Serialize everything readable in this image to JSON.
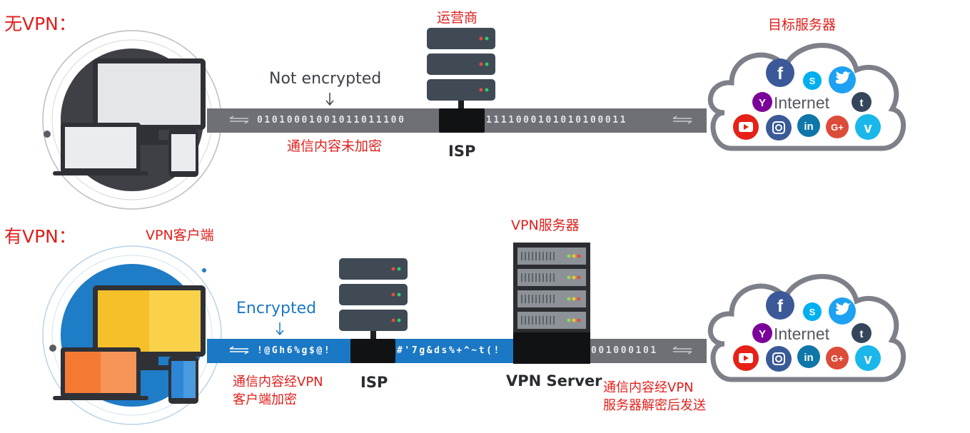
{
  "top": {
    "heading": "无VPN：",
    "isp_operator_label": "运营商",
    "target_server_label": "目标服务器",
    "not_encrypted": "Not encrypted",
    "left_bits": "01010001001011011100",
    "right_bits": "1111000101010100011",
    "note": "通信内容未加密",
    "isp": "ISP",
    "internet": "Internet"
  },
  "bottom": {
    "heading": "有VPN：",
    "client_label": "VPN客户端",
    "vpn_server_label": "VPN服务器",
    "encrypted": "Encrypted",
    "enc_text_1": "!@Gh6%g$@!",
    "enc_text_2": "#'7g&ds%+^~t(!",
    "right_bits": "001000101",
    "isp": "ISP",
    "vpn_server": "VPN Server",
    "note_client_line1": "通信内容经VPN",
    "note_client_line2": "客户端加密",
    "note_server_line1": "通信内容经VPN",
    "note_server_line2": "服务器解密后发送",
    "internet": "Internet"
  },
  "colors": {
    "red_label": "#e0201c",
    "tube_gray": "#6e7076",
    "tube_blue": "#1b78c4",
    "server_dark": "#3f4a55",
    "screen_yellow": "#f6c02a",
    "laptop_orange": "#f47a33"
  },
  "icons": [
    "facebook-icon",
    "skype-icon",
    "twitter-icon",
    "yahoo-icon",
    "tumblr-icon",
    "youtube-icon",
    "instagram-icon",
    "linkedin-icon",
    "google-plus-icon",
    "vimeo-icon"
  ]
}
